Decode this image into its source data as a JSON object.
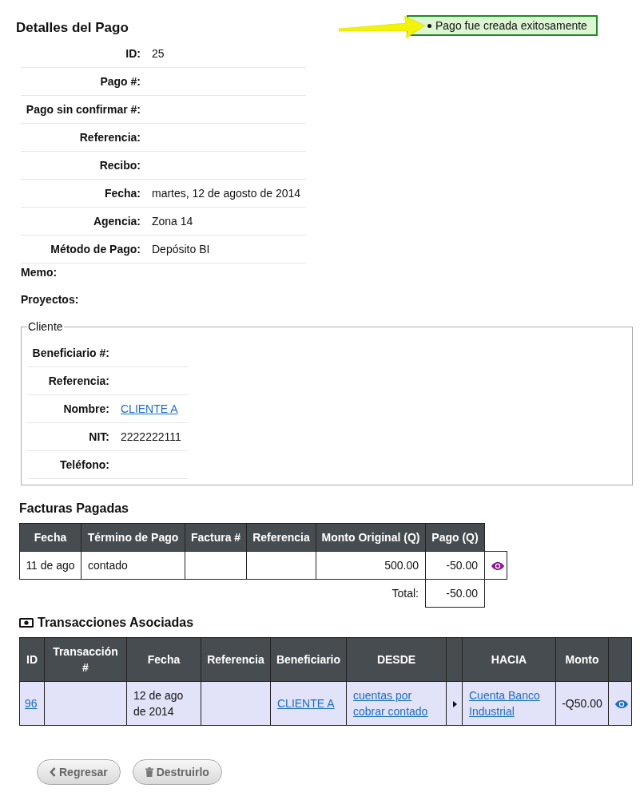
{
  "page": {
    "title": "Detalles del Pago"
  },
  "flash": {
    "messages": [
      "Pago fue creada exitosamente"
    ]
  },
  "details": {
    "fields": [
      {
        "label": "ID:",
        "value": "25"
      },
      {
        "label": "Pago #:"
      },
      {
        "label": "Pago sin confirmar #:"
      },
      {
        "label": "Referencia:"
      },
      {
        "label": "Recibo:"
      },
      {
        "label": "Fecha:",
        "value": "martes, 12 de agosto de 2014"
      },
      {
        "label": "Agencia:",
        "value": "Zona 14"
      },
      {
        "label": "Método de Pago:",
        "value": "Depósito BI"
      }
    ]
  },
  "notes": [
    {
      "label": "Memo:"
    },
    {
      "label": "Proyectos:"
    }
  ],
  "client": {
    "legend": "Cliente",
    "fields": [
      {
        "label": "Beneficiario #:"
      },
      {
        "label": "Referencia:"
      },
      {
        "label": "Nombre:",
        "value": "CLIENTE A",
        "kind": "link"
      },
      {
        "label": "NIT:",
        "value": "2222222111",
        "kind": "text"
      },
      {
        "label": "Teléfono:"
      }
    ]
  },
  "invoices": {
    "title": "Facturas Pagadas",
    "columns": {
      "date": "Fecha",
      "payment_term": "Término de Pago",
      "invoice_no": "Factura #",
      "reference": "Referencia",
      "original_amount": "Monto Original (Q)",
      "payment": "Pago (Q)"
    },
    "rows": [
      {
        "date": "11 de ago",
        "payment_term": "contado",
        "original_amount": "500.00",
        "payment": "-50.00",
        "visited": true
      }
    ],
    "total": {
      "label": "Total:",
      "value": "-50.00"
    }
  },
  "transactions": {
    "title": "Transacciones Asociadas",
    "columns": {
      "id": "ID",
      "transaction_no": "Transacción #",
      "date": "Fecha",
      "reference": "Referencia",
      "beneficiary": "Beneficiario",
      "from": "DESDE",
      "to": "HACIA",
      "amount": "Monto"
    },
    "rows": [
      {
        "id": "96",
        "date": "12 de ago de 2014",
        "beneficiary": "CLIENTE A",
        "from": "cuentas por cobrar contado",
        "to": "Cuenta Banco Industrial",
        "amount": "-Q50.00",
        "visited": false
      }
    ]
  },
  "buttons": [
    {
      "label": "Regresar",
      "kind": "back"
    },
    {
      "label": "Destruirlo",
      "kind": "delete"
    }
  ]
}
